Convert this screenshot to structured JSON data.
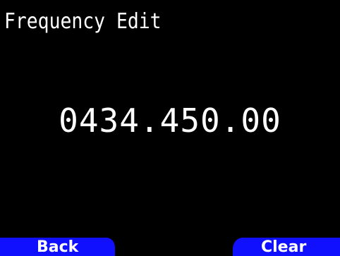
{
  "screen": {
    "title": "Frequency Edit",
    "frequency_value": "0434.450.00"
  },
  "softkeys": {
    "left_label": "Back",
    "right_label": "Clear"
  },
  "colors": {
    "background": "#000000",
    "text": "#ffffff",
    "softkey_background": "#1010ff"
  }
}
